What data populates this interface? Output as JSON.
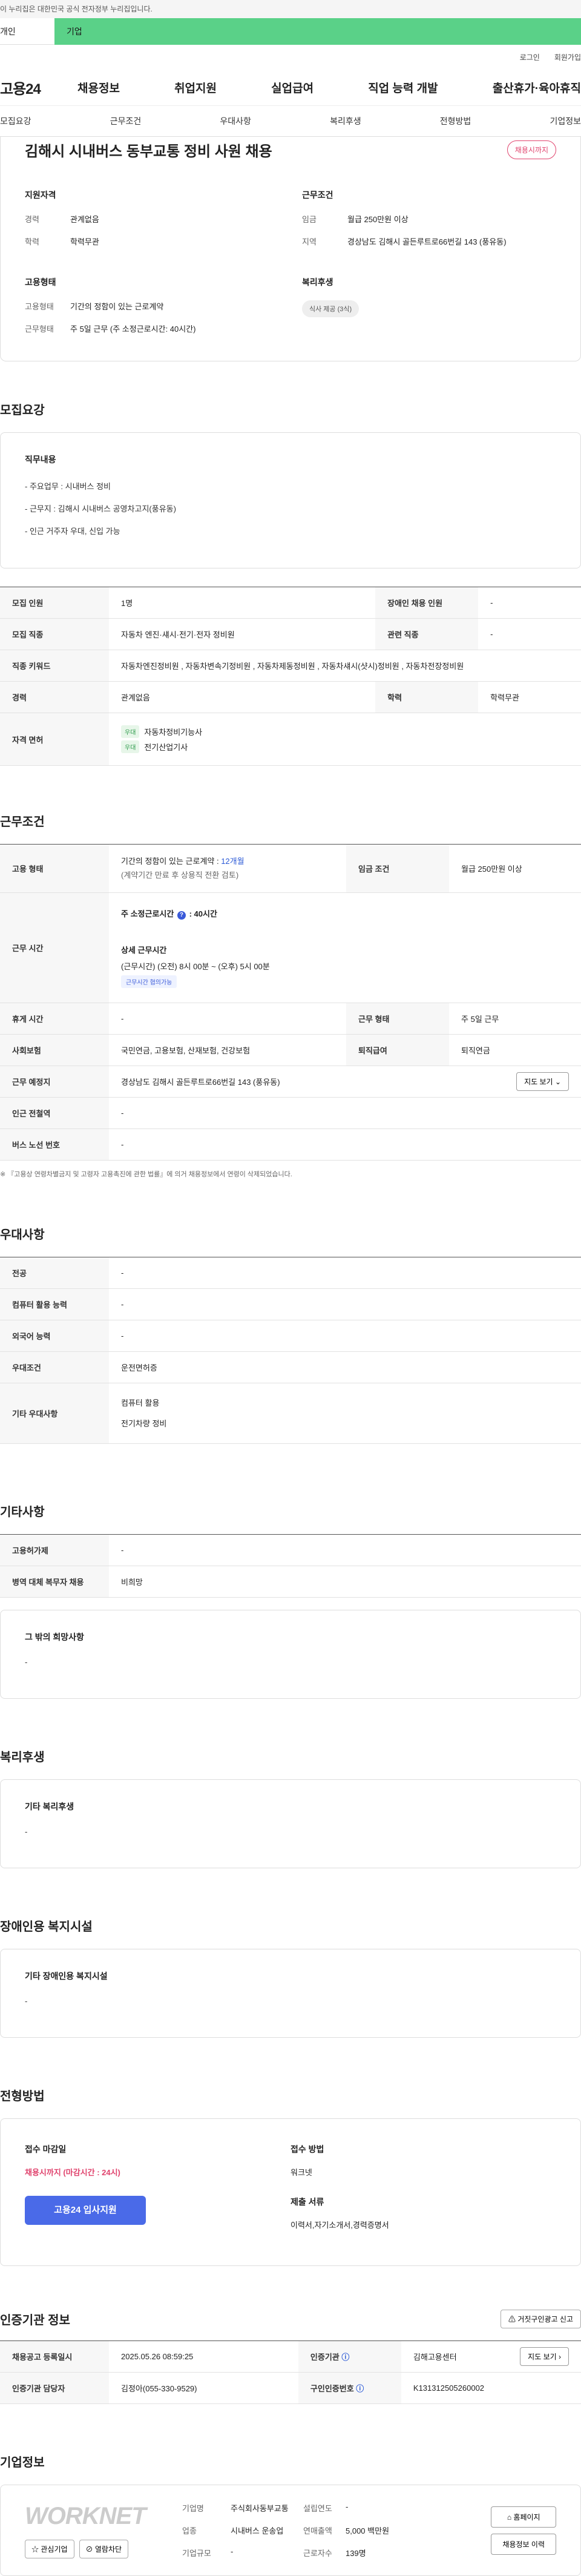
{
  "topbar": {
    "notice": "이 누리집은 대한민국 공식 전자정부 누리집입니다."
  },
  "user_tabs": [
    "개인",
    "기업"
  ],
  "util_links": [
    "로그인",
    "회원가입"
  ],
  "logo": "고용24",
  "gnb": [
    "채용정보",
    "취업지원",
    "실업급여",
    "직업 능력 개발",
    "출산휴가·육아휴직"
  ],
  "subnav": [
    "모집요강",
    "근무조건",
    "우대사항",
    "복리후생",
    "전형방법",
    "기업정보"
  ],
  "job": {
    "title": "김해시 시내버스 동부교통 정비 사원 채용",
    "deadline_badge": "채용시까지",
    "sections": {
      "qual": {
        "title": "지원자격",
        "rows": [
          [
            "경력",
            "관계없음"
          ],
          [
            "학력",
            "학력무관"
          ]
        ]
      },
      "cond": {
        "title": "근무조건",
        "rows": [
          [
            "임금",
            "월급 250만원 이상"
          ],
          [
            "지역",
            "경상남도 김해시 골든루트로66번길 143 (풍유동)"
          ]
        ]
      },
      "emp": {
        "title": "고용형태",
        "rows": [
          [
            "고용형태",
            "기간의 정함이 있는 근로계약"
          ],
          [
            "근무형태",
            "주 5일 근무 (주 소정근로시간: 40시간)"
          ]
        ]
      },
      "welfare": {
        "title": "복리후생",
        "chip": "식사 제공 (3식)"
      }
    }
  },
  "recruit": {
    "title": "모집요강",
    "duty_title": "직무내용",
    "duty_lines": [
      "- 주요업무 : 시내버스 정비",
      "- 근무지 : 김해시 시내버스 공영차고지(풍유동)",
      "- 인근 거주자 우대, 신입 가능"
    ],
    "table": {
      "r1": [
        "모집 인원",
        "1명",
        "장애인 채용 인원",
        "-"
      ],
      "r2": [
        "모집 직종",
        "자동차 엔진·섀시·전기·전자 정비원",
        "관련 직종",
        "-"
      ],
      "r3": [
        "직종 키워드",
        "자동차엔진정비원 , 자동차변속기정비원 , 자동차제동정비원 , 자동차섀시(샷시)정비원 , 자동차전장정비원"
      ],
      "r4": [
        "경력",
        "관계없음",
        "학력",
        "학력무관"
      ],
      "r5_label": "자격 면허",
      "licenses": [
        {
          "tag": "우대",
          "name": "자동차정비기능사"
        },
        {
          "tag": "우대",
          "name": "전기산업기사"
        }
      ]
    }
  },
  "work": {
    "title": "근무조건",
    "emp_label": "고용 형태",
    "emp_value": "기간의 정함이 있는 근로계약 : ",
    "emp_months": "12개월",
    "emp_note": "(계약기간 만료 후 상용직 전환 검토)",
    "wage_label": "임금 조건",
    "wage_value": "월급 250만원 이상",
    "hours_label": "근무 시간",
    "hours_week": "주 소정근로시간",
    "hours_week_value": ": 40시간",
    "hours_detail_title": "상세 근무시간",
    "hours_detail": "(근무시간) (오전) 8시 00분 ~ (오후) 5시 00분",
    "hours_pill": "근무시간 협의가능",
    "rest_label": "휴게 시간",
    "rest_value": "-",
    "shift_label": "근무 형태",
    "shift_value": "주 5일 근무",
    "ins_label": "사회보험",
    "ins_value": "국민연금, 고용보험, 산재보험, 건강보험",
    "sev_label": "퇴직급여",
    "sev_value": "퇴직연금",
    "loc_label": "근무 예정지",
    "loc_value": "경상남도 김해시 골든루트로66번길 143 (풍유동)",
    "map_btn": "지도 보기",
    "subway_label": "인근 전철역",
    "subway_value": "-",
    "bus_label": "버스 노선 번호",
    "bus_value": "-",
    "note": "※ 『고용상 연령차별금지 및 고령자 고용촉진에 관한 법률』에 의거 채용정보에서 연령이 삭제되었습니다."
  },
  "pref": {
    "title": "우대사항",
    "rows": [
      [
        "전공",
        "-"
      ],
      [
        "컴퓨터 활용 능력",
        "-"
      ],
      [
        "외국어 능력",
        "-"
      ],
      [
        "우대조건",
        "운전면허증"
      ]
    ],
    "other_label": "기타 우대사항",
    "other_lines": [
      "컴퓨터 활용",
      "전기차량 정비"
    ]
  },
  "etc": {
    "title": "기타사항",
    "rows": [
      [
        "고용허가제",
        "-"
      ],
      [
        "병역 대체 복무자 채용",
        "비희망"
      ]
    ],
    "wish_title": "그 밖의 희망사항",
    "wish_value": "-"
  },
  "benefits": {
    "title": "복리후생",
    "sub": "기타 복리후생",
    "value": "-"
  },
  "disability": {
    "title": "장애인용 복지시설",
    "sub": "기타 장애인용 복지시설",
    "value": "-"
  },
  "process": {
    "title": "전형방법",
    "deadline_title": "접수 마감일",
    "deadline_value": "채용시까지 (마감시간 : 24시)",
    "apply_btn": "고용24 입사지원",
    "method_title": "접수 방법",
    "method_value": "워크넷",
    "docs_title": "제출 서류",
    "docs_value": "이력서,자기소개서,경력증명서"
  },
  "agency": {
    "title": "인증기관 정보",
    "report_btn": "거짓구인광고 신고",
    "r1": [
      "채용공고 등록일시",
      "2025.05.26 08:59:25",
      "인증기관",
      "김해고용센터"
    ],
    "agency_btn": "지도 보기",
    "r2": [
      "인증기관 담당자",
      "김정아(055-330-9529)",
      "구인인증번호",
      "K131312505260002"
    ]
  },
  "company": {
    "title": "기업정보",
    "logo_text": "WORKNET",
    "rows": [
      [
        "기업명",
        "주식회사동부교통",
        "설립연도",
        "-"
      ],
      [
        "업종",
        "시내버스 운송업",
        "연매출액",
        "5,000 백만원"
      ],
      [
        "기업규모",
        "-",
        "근로자수",
        "139명"
      ]
    ],
    "btn_home": "홈페이지",
    "btn_other": "채용정보 이력",
    "btn_interest": "관심기업",
    "btn_block": "열람차단"
  }
}
